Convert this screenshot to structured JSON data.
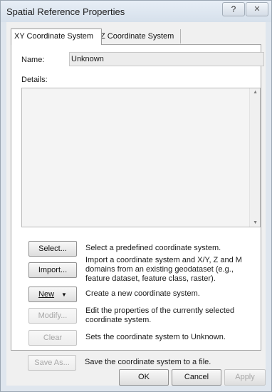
{
  "window": {
    "title": "Spatial Reference Properties",
    "help_glyph": "?",
    "close_glyph": "✕"
  },
  "tabs": [
    {
      "label": "XY Coordinate System",
      "active": true
    },
    {
      "label": "Z Coordinate System",
      "active": false
    }
  ],
  "info": {
    "name_label": "Name:",
    "name_value": "Unknown",
    "details_label": "Details:",
    "details_value": ""
  },
  "actions": [
    {
      "label": "Select...",
      "description": "Select a predefined coordinate system.",
      "enabled": true
    },
    {
      "label": "Import...",
      "description": "Import a coordinate system and X/Y, Z and M domains from an existing geodataset (e.g., feature dataset, feature class, raster).",
      "enabled": true
    },
    {
      "label": "New",
      "description": "Create a new coordinate system.",
      "enabled": true,
      "has_dropdown": true
    },
    {
      "label": "Modify...",
      "description": "Edit the properties of the currently selected coordinate system.",
      "enabled": false
    },
    {
      "label": "Clear",
      "description": "Sets the coordinate system to Unknown.",
      "enabled": false
    },
    {
      "label": "Save As...",
      "description": "Save the coordinate system to a file.",
      "enabled": false
    }
  ],
  "footer": {
    "ok_label": "OK",
    "cancel_label": "Cancel",
    "apply_label": "Apply"
  }
}
